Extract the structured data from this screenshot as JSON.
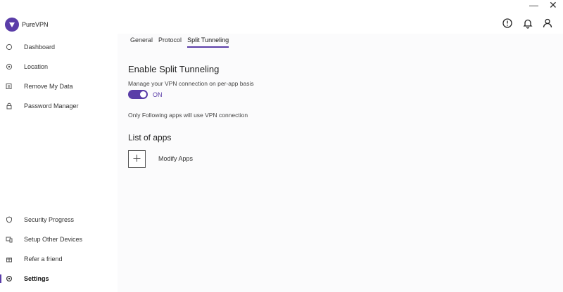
{
  "app": {
    "name": "PureVPN"
  },
  "window": {
    "minimize_glyph": "—",
    "close_glyph": "✕"
  },
  "sidebar": {
    "top_items": [
      {
        "label": "Dashboard",
        "icon": "circle-icon"
      },
      {
        "label": "Location",
        "icon": "location-icon"
      },
      {
        "label": "Remove My Data",
        "icon": "data-removal-icon"
      },
      {
        "label": "Password Manager",
        "icon": "lock-icon"
      }
    ],
    "bottom_items": [
      {
        "label": "Security Progress",
        "icon": "shield-icon"
      },
      {
        "label": "Setup Other Devices",
        "icon": "devices-icon"
      },
      {
        "label": "Refer a friend",
        "icon": "gift-icon"
      },
      {
        "label": "Settings",
        "icon": "gear-icon",
        "active": true
      }
    ]
  },
  "header_icons": [
    "help-icon",
    "bell-icon",
    "user-icon"
  ],
  "tabs": {
    "general": "General",
    "protocol": "Protocol",
    "split": "Split Tunneling",
    "active": "Split Tunneling"
  },
  "split_tunneling": {
    "title": "Enable Split Tunneling",
    "description": "Manage your VPN connection on per-app basis",
    "toggle_state": "ON",
    "info": "Only Following apps will use VPN connection",
    "list_title": "List of apps",
    "modify_label": "Modify Apps"
  },
  "colors": {
    "accent": "#5a3da8",
    "content_bg": "#fbfbfc"
  }
}
